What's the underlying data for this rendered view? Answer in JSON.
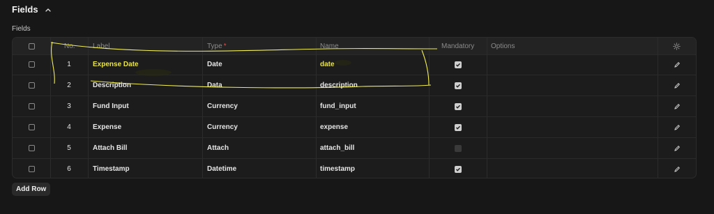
{
  "section": {
    "title": "Fields",
    "subtitle": "Fields"
  },
  "table": {
    "headers": {
      "no": "No.",
      "label": "Label",
      "type": "Type",
      "type_required": "*",
      "name": "Name",
      "mandatory": "Mandatory",
      "options": "Options"
    },
    "rows": [
      {
        "no": "1",
        "label": "Expense Date",
        "type": "Date",
        "name": "date",
        "mandatory": true
      },
      {
        "no": "2",
        "label": "Description",
        "type": "Data",
        "name": "description",
        "mandatory": true
      },
      {
        "no": "3",
        "label": "Fund Input",
        "type": "Currency",
        "name": "fund_input",
        "mandatory": true
      },
      {
        "no": "4",
        "label": "Expense",
        "type": "Currency",
        "name": "expense",
        "mandatory": true
      },
      {
        "no": "5",
        "label": "Attach Bill",
        "type": "Attach",
        "name": "attach_bill",
        "mandatory": false
      },
      {
        "no": "6",
        "label": "Timestamp",
        "type": "Datetime",
        "name": "timestamp",
        "mandatory": true
      }
    ]
  },
  "add_row_label": "Add Row",
  "colors": {
    "background": "#171717",
    "highlight_text": "#e8e34a",
    "annotation_stroke": "#f2ee55",
    "required_marker": "#e24c4c"
  }
}
